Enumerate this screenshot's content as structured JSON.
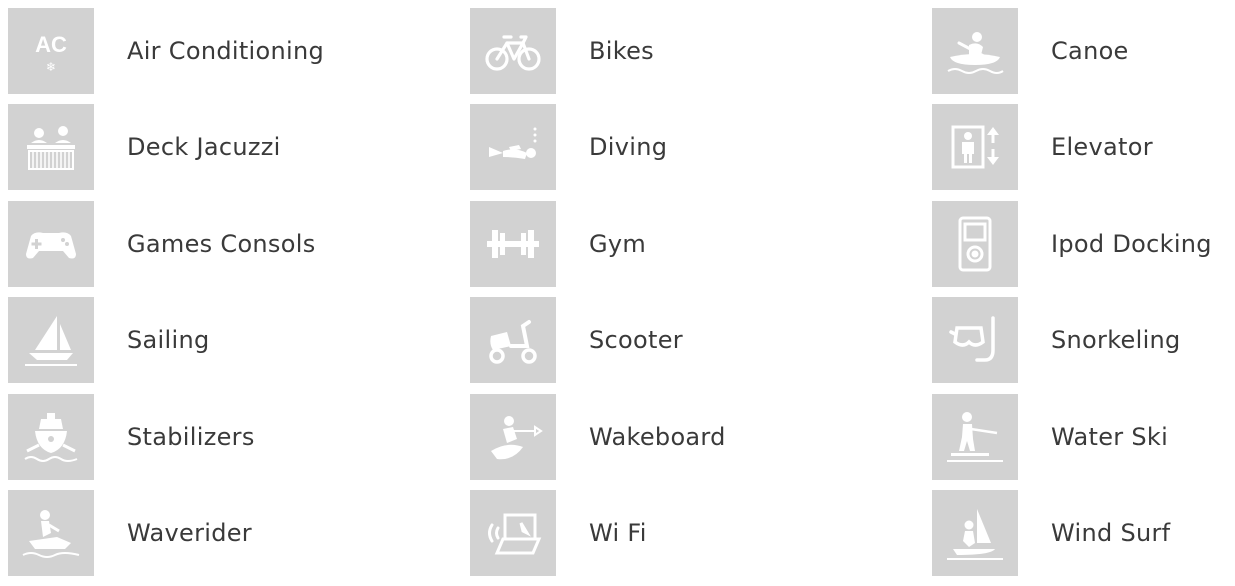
{
  "amenities": [
    {
      "label": "Air Conditioning",
      "icon": "air-conditioning-icon",
      "icon_text": "AC",
      "icon_glyph": "❄"
    },
    {
      "label": "Bikes",
      "icon": "bike-icon"
    },
    {
      "label": "Canoe",
      "icon": "canoe-icon"
    },
    {
      "label": "Deck Jacuzzi",
      "icon": "jacuzzi-icon"
    },
    {
      "label": "Diving",
      "icon": "diver-icon"
    },
    {
      "label": "Elevator",
      "icon": "elevator-icon"
    },
    {
      "label": "Games Consols",
      "icon": "gamepad-icon"
    },
    {
      "label": "Gym",
      "icon": "dumbbell-icon"
    },
    {
      "label": "Ipod Docking",
      "icon": "ipod-icon"
    },
    {
      "label": "Sailing",
      "icon": "sailboat-icon"
    },
    {
      "label": "Scooter",
      "icon": "scooter-icon"
    },
    {
      "label": "Snorkeling",
      "icon": "snorkel-mask-icon"
    },
    {
      "label": "Stabilizers",
      "icon": "ship-stabilizer-icon"
    },
    {
      "label": "Wakeboard",
      "icon": "wakeboard-icon"
    },
    {
      "label": "Water Ski",
      "icon": "water-ski-icon"
    },
    {
      "label": "Waverider",
      "icon": "jet-ski-icon"
    },
    {
      "label": "Wi Fi",
      "icon": "wifi-laptop-icon"
    },
    {
      "label": "Wind Surf",
      "icon": "windsurf-icon"
    }
  ],
  "colors": {
    "tile_background": "#d2d2d2",
    "icon": "#ffffff",
    "label_text": "#3a3a3a"
  }
}
